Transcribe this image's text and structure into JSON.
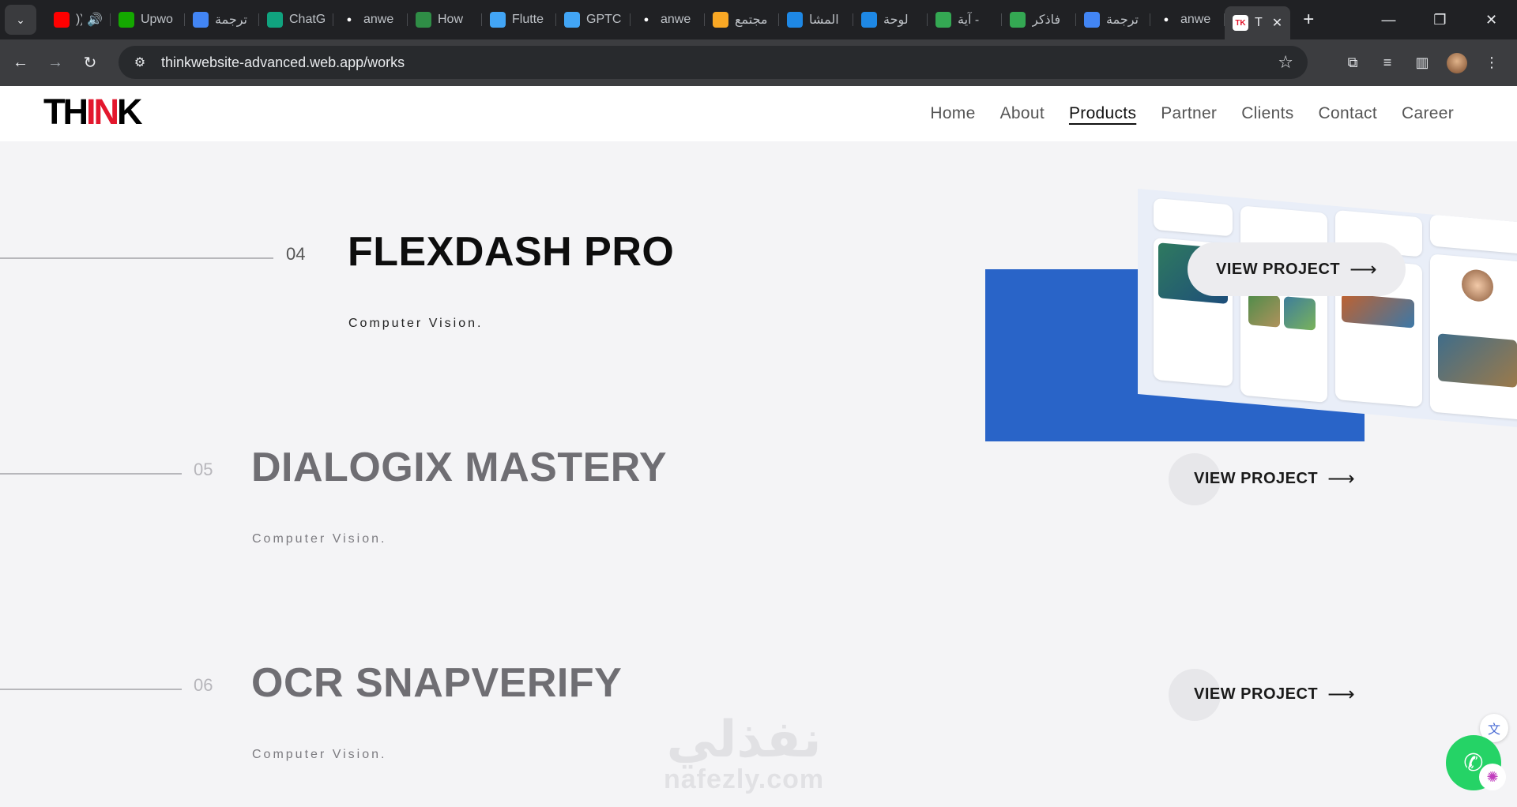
{
  "browser": {
    "tabs": [
      {
        "title": "))",
        "icon": "youtube-icon",
        "color": "#ff0000",
        "audio": true
      },
      {
        "title": "Upwo",
        "icon": "upwork-icon",
        "color": "#14a800"
      },
      {
        "title": "ترجمة",
        "icon": "google-translate-icon",
        "color": "#4285f4"
      },
      {
        "title": "ChatG",
        "icon": "chatgpt-icon",
        "color": "#10a37f"
      },
      {
        "title": "anwe",
        "icon": "github-icon",
        "color": "#ffffff"
      },
      {
        "title": "How",
        "icon": "geeksforgeeks-icon",
        "color": "#2f8d46"
      },
      {
        "title": "Flutte",
        "icon": "flutter-icon",
        "color": "#42a5f5"
      },
      {
        "title": "GPTC",
        "icon": "flutter-icon",
        "color": "#42a5f5"
      },
      {
        "title": "anwe",
        "icon": "github-icon",
        "color": "#ffffff"
      },
      {
        "title": "مجتمع",
        "icon": "hsoub-icon",
        "color": "#f9a825"
      },
      {
        "title": "المشا",
        "icon": "mostaql-icon",
        "color": "#1e88e5"
      },
      {
        "title": "لوحة",
        "icon": "mostaql-icon",
        "color": "#1e88e5"
      },
      {
        "title": "آية -",
        "icon": "google-play-icon",
        "color": "#34a853"
      },
      {
        "title": "فاذكر",
        "icon": "google-play-icon",
        "color": "#34a853"
      },
      {
        "title": "ترجمة",
        "icon": "google-translate-icon",
        "color": "#4285f4"
      },
      {
        "title": "anwe",
        "icon": "github-icon",
        "color": "#ffffff"
      }
    ],
    "active_tab": {
      "title": "T",
      "icon": "think-favicon-icon"
    },
    "url": "thinkwebsite-advanced.web.app/works"
  },
  "site": {
    "logo": {
      "part1": "TH",
      "part2": "IN",
      "part3": "K"
    },
    "nav": [
      "Home",
      "About",
      "Products",
      "Partner",
      "Clients",
      "Contact",
      "Career"
    ],
    "active_nav": "Products"
  },
  "works": [
    {
      "number": "04",
      "title": "FLEXDASH PRO",
      "subtitle": "Computer Vision.",
      "cta": "VIEW PROJECT",
      "active": true
    },
    {
      "number": "05",
      "title": "DIALOGIX MASTERY",
      "subtitle": "Computer Vision.",
      "cta": "VIEW PROJECT",
      "active": false
    },
    {
      "number": "06",
      "title": "OCR SNAPVERIFY",
      "subtitle": "Computer Vision.",
      "cta": "VIEW PROJECT",
      "active": false
    }
  ],
  "watermark": {
    "arabic": "نفذلي",
    "latin": "nafezly.com"
  },
  "colors": {
    "accent_blue": "#2964c8",
    "logo_red": "#e3172d",
    "chrome_bg": "#202124"
  }
}
